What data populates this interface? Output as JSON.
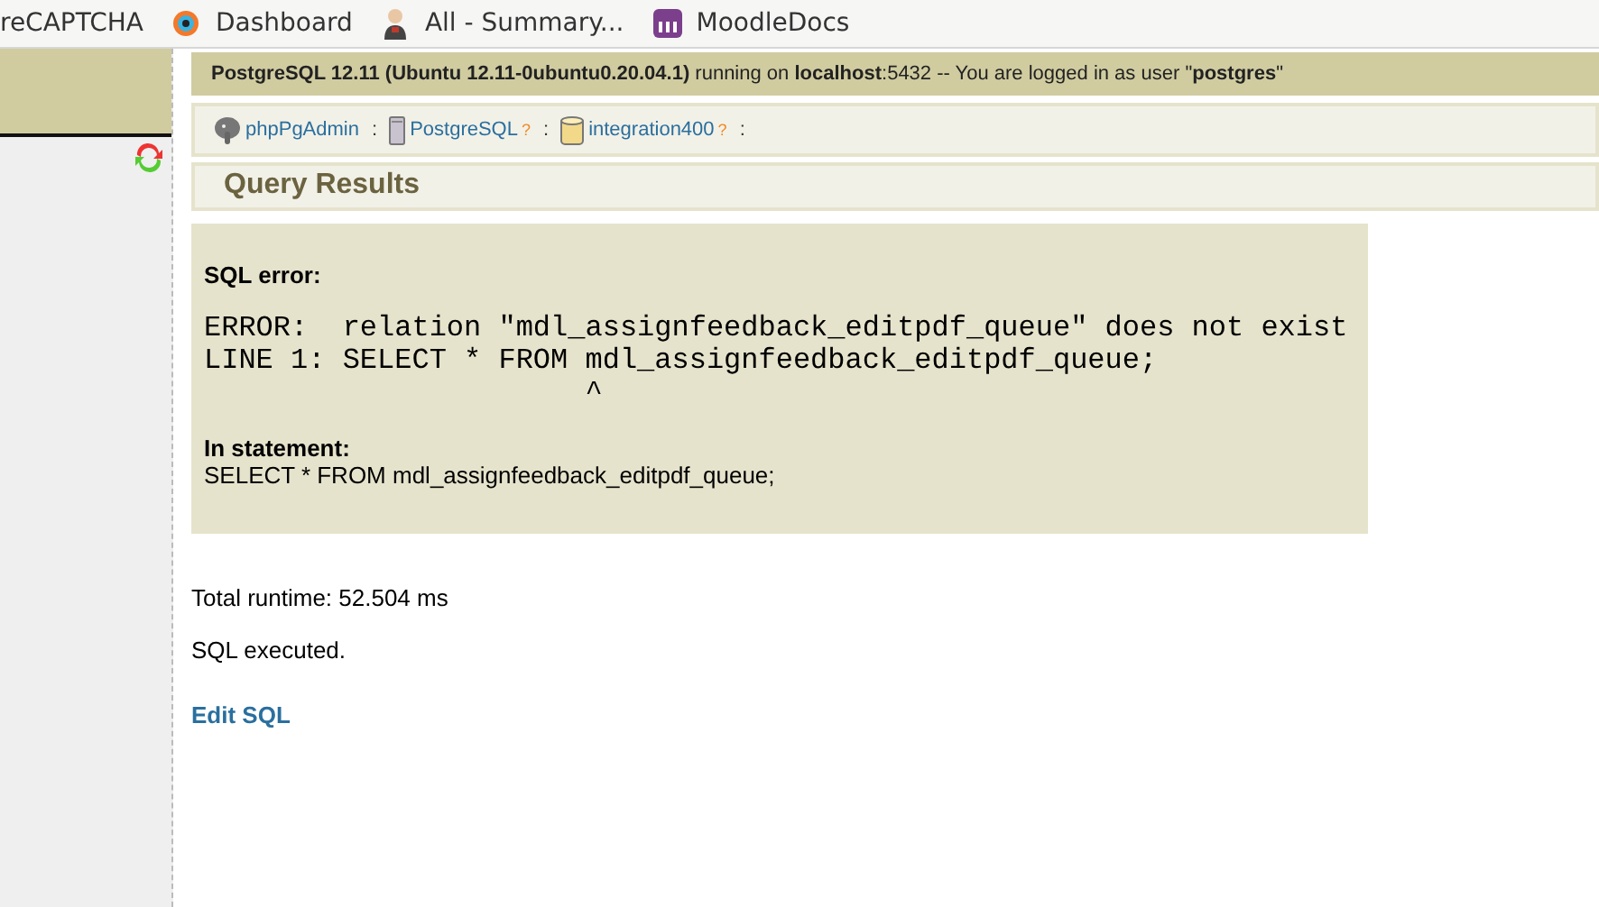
{
  "bookmarks": [
    {
      "label": "reCAPTCHA",
      "kind": "plain"
    },
    {
      "label": "Dashboard",
      "kind": "icon"
    },
    {
      "label": "All - Summary...",
      "kind": "icon"
    },
    {
      "label": "MoodleDocs",
      "kind": "icon"
    }
  ],
  "server_info": "**PostgreSQL 12.11 (Ubuntu 12.11-0ubuntu0.20.04.1)** running on **localhost**:5432 -- You are logged in as user \"**postgres**\"",
  "trail": [
    {
      "label": "phpPgAdmin",
      "separator": ":"
    },
    {
      "label": "PostgreSQL",
      "help": "?",
      "separator": ":"
    },
    {
      "label": "integration400",
      "help": "?",
      "separator": ":"
    }
  ],
  "title": "Query Results",
  "error": {
    "heading": "SQL error:",
    "message_lines": [
      "ERROR:  relation \"mdl_assignfeedback_editpdf_queue\" does not exist",
      "LINE 1: SELECT * FROM mdl_assignfeedback_editpdf_queue;",
      "                      ^"
    ],
    "statement_label": "In statement:",
    "statement": "SELECT * FROM mdl_assignfeedback_editpdf_queue;"
  },
  "runtime": "Total runtime: 52.504 ms",
  "status": "SQL executed.",
  "edit_link": "Edit SQL"
}
